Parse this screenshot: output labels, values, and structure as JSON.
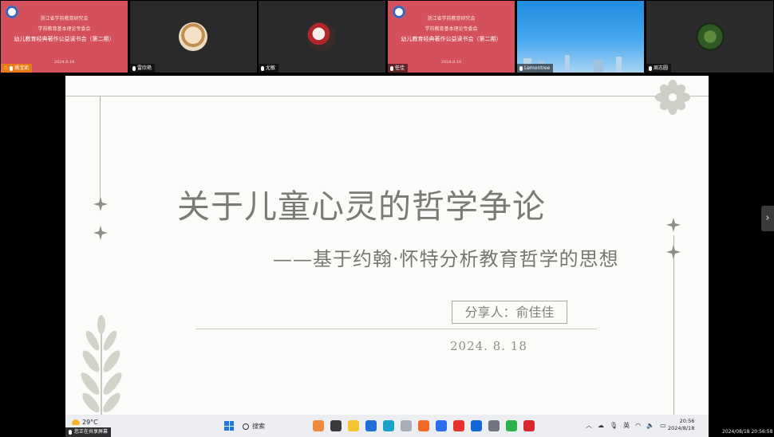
{
  "participants": [
    {
      "name": "姚宝凯",
      "kind": "banner",
      "org_line1": "浙江省学前教育研究会",
      "org_line2": "学前教育基本理论专委会",
      "meeting": "幼儿教育经典著作公益读书会（第二期）",
      "date": "2024.8.18",
      "warning": "⚠"
    },
    {
      "name": "雷欣艳",
      "kind": "avatar"
    },
    {
      "name": "尤敏",
      "kind": "avatar"
    },
    {
      "name": "任佳",
      "kind": "banner",
      "org_line1": "浙江省学前教育研究会",
      "org_line2": "学前教育基本理论专委会",
      "meeting": "幼儿教育经典著作公益读书会（第二期）",
      "date": "2024.8.18"
    },
    {
      "name": "Lemontree",
      "kind": "sky"
    },
    {
      "name": "周志圆",
      "kind": "avatar"
    }
  ],
  "slide": {
    "title": "关于儿童心灵的哲学争论",
    "subtitle": "——基于约翰·怀特分析教育哲学的思想",
    "presenter": "分享人：俞佳佳",
    "date": "2024. 8. 18"
  },
  "next_arrow": "›",
  "taskbar": {
    "temperature": "29°C",
    "screen_share_label": "您正在共享屏幕",
    "search_label": "搜索",
    "ime_label": "英",
    "time": "20:56",
    "date": "2024/8/18",
    "apps": [
      {
        "name": "widgets",
        "color": "#f08a3c"
      },
      {
        "name": "task-view",
        "color": "#3a3a3a"
      },
      {
        "name": "file-explorer",
        "color": "#f4c430"
      },
      {
        "name": "store",
        "color": "#1f6fd6"
      },
      {
        "name": "edge",
        "color": "#1aa3c9"
      },
      {
        "name": "settings",
        "color": "#a8adb8"
      },
      {
        "name": "firefox",
        "color": "#f06a25"
      },
      {
        "name": "meeting",
        "color": "#2c6df0"
      },
      {
        "name": "wps",
        "color": "#e6312f"
      },
      {
        "name": "photos",
        "color": "#1467d6"
      },
      {
        "name": "gear",
        "color": "#6f7480"
      },
      {
        "name": "wechat",
        "color": "#2bb24c"
      },
      {
        "name": "wps-office",
        "color": "#d8262b"
      }
    ]
  },
  "recording_timestamp": "2024/08/18 20:56:58"
}
